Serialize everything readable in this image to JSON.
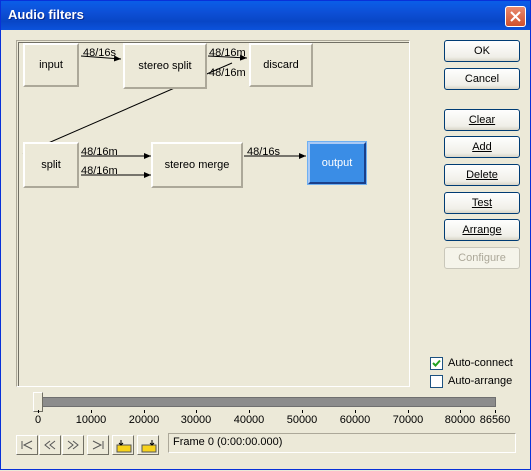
{
  "window": {
    "title": "Audio filters"
  },
  "graph": {
    "nodes": {
      "input": "input",
      "stereo_split": "stereo split",
      "discard": "discard",
      "split": "split",
      "stereo_merge": "stereo merge",
      "output": "output"
    },
    "pins": {
      "input_out": "48/16s",
      "stereo_split_out1": "48/16m",
      "stereo_split_out2": "48/16m",
      "split_out1": "48/16m",
      "split_out2": "48/16m",
      "stereo_merge_out": "48/16s"
    },
    "selected_node": "output"
  },
  "buttons": {
    "ok": "OK",
    "cancel": "Cancel",
    "clear": "Clear",
    "add": "Add",
    "delete": "Delete",
    "test": "Test",
    "arrange": "Arrange",
    "configure": "Configure"
  },
  "options": {
    "auto_connect": {
      "label": "Auto-connect",
      "checked": true
    },
    "auto_arrange": {
      "label": "Auto-arrange",
      "checked": false
    }
  },
  "timeline": {
    "ticks": [
      "0",
      "10000",
      "20000",
      "30000",
      "40000",
      "50000",
      "60000",
      "70000",
      "80000",
      "86560"
    ],
    "position": 0,
    "frame_text": "Frame 0 (0:00:00.000)"
  },
  "icons": {
    "close": "close-icon",
    "start": "go-to-start-icon",
    "prev": "step-back-icon",
    "next": "step-forward-icon",
    "end": "go-to-end-icon",
    "mark_in": "mark-in-icon",
    "mark_out": "mark-out-icon"
  }
}
